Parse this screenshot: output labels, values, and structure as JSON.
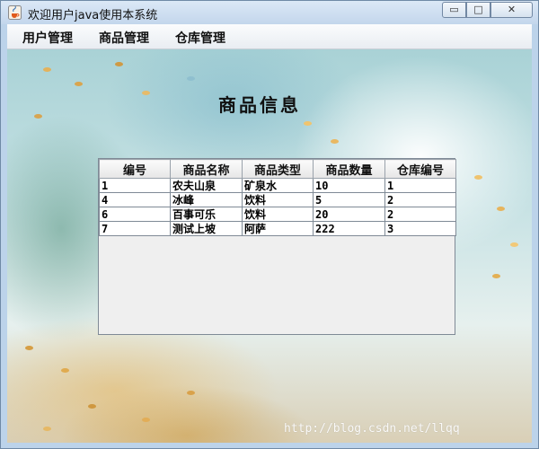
{
  "window": {
    "title": "欢迎用户java使用本系统",
    "minimize_glyph": "▭",
    "maximize_glyph": "□",
    "close_glyph": "✕"
  },
  "menubar": {
    "items": [
      "用户管理",
      "商品管理",
      "仓库管理"
    ]
  },
  "main": {
    "heading": "商品信息",
    "table": {
      "columns": [
        "编号",
        "商品名称",
        "商品类型",
        "商品数量",
        "仓库编号"
      ],
      "rows": [
        [
          "1",
          "农夫山泉",
          "矿泉水",
          "10",
          "1"
        ],
        [
          "4",
          "冰峰",
          "饮料",
          "5",
          "2"
        ],
        [
          "6",
          "百事可乐",
          "饮料",
          "20",
          "2"
        ],
        [
          "7",
          "测试上坡",
          "阿萨",
          "222",
          "3"
        ]
      ]
    }
  },
  "watermark": "http://blog.csdn.net/llqq",
  "colors": {
    "title_bar": "#c3d6ec",
    "table_border": "#7f8a96",
    "table_empty": "#efefef"
  },
  "icons": {
    "app": "java-coffee-cup-icon"
  }
}
